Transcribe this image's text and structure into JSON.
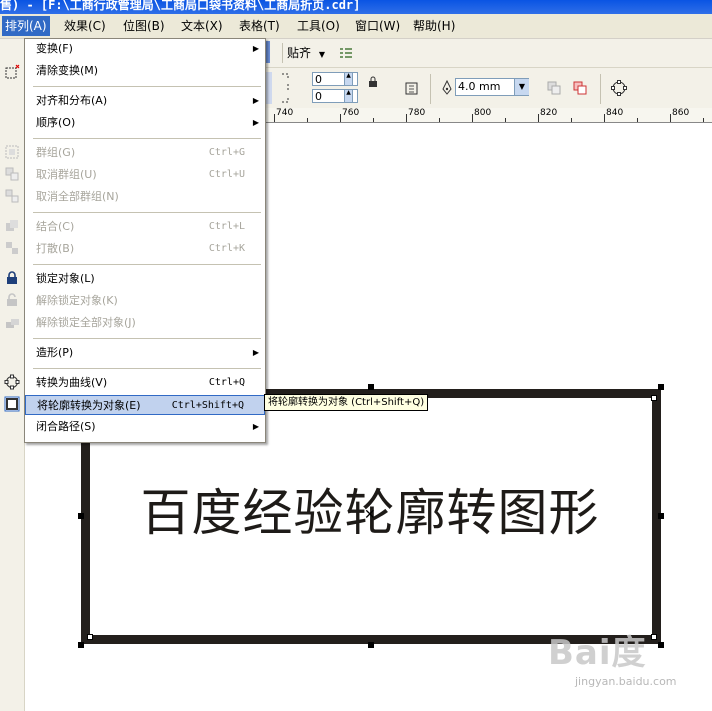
{
  "window": {
    "title": "售) - [F:\\工商行政管理局\\工商局口袋书资料\\工商局折页.cdr]"
  },
  "menubar": {
    "items": [
      {
        "label": "排列(A)"
      },
      {
        "label": "效果(C)"
      },
      {
        "label": "位图(B)"
      },
      {
        "label": "文本(X)"
      },
      {
        "label": "表格(T)"
      },
      {
        "label": "工具(O)"
      },
      {
        "label": "窗口(W)"
      },
      {
        "label": "帮助(H)"
      }
    ]
  },
  "toolbar1": {
    "snap_label": "贴齐"
  },
  "toolbar2": {
    "field1": "0",
    "field2": "0",
    "outline_width": "4.0 mm"
  },
  "ruler": {
    "labels": [
      "740",
      "760",
      "780",
      "800",
      "820",
      "840",
      "860"
    ]
  },
  "arrange_menu": {
    "items": [
      {
        "label": "变换(F)",
        "shortcut": "",
        "submenu": true,
        "enabled": true
      },
      {
        "label": "清除变换(M)",
        "shortcut": "",
        "submenu": false,
        "enabled": true
      },
      {
        "label": "对齐和分布(A)",
        "shortcut": "",
        "submenu": true,
        "enabled": true
      },
      {
        "label": "顺序(O)",
        "shortcut": "",
        "submenu": true,
        "enabled": true
      },
      {
        "label": "群组(G)",
        "shortcut": "Ctrl+G",
        "submenu": false,
        "enabled": false
      },
      {
        "label": "取消群组(U)",
        "shortcut": "Ctrl+U",
        "submenu": false,
        "enabled": false
      },
      {
        "label": "取消全部群组(N)",
        "shortcut": "",
        "submenu": false,
        "enabled": false
      },
      {
        "label": "结合(C)",
        "shortcut": "Ctrl+L",
        "submenu": false,
        "enabled": false
      },
      {
        "label": "打散(B)",
        "shortcut": "Ctrl+K",
        "submenu": false,
        "enabled": false
      },
      {
        "label": "锁定对象(L)",
        "shortcut": "",
        "submenu": false,
        "enabled": true
      },
      {
        "label": "解除锁定对象(K)",
        "shortcut": "",
        "submenu": false,
        "enabled": false
      },
      {
        "label": "解除锁定全部对象(J)",
        "shortcut": "",
        "submenu": false,
        "enabled": false
      },
      {
        "label": "造形(P)",
        "shortcut": "",
        "submenu": true,
        "enabled": true
      },
      {
        "label": "转换为曲线(V)",
        "shortcut": "Ctrl+Q",
        "submenu": false,
        "enabled": true
      },
      {
        "label": "将轮廓转换为对象(E)",
        "shortcut": "Ctrl+Shift+Q",
        "submenu": false,
        "enabled": true,
        "highlighted": true
      },
      {
        "label": "闭合路径(S)",
        "shortcut": "",
        "submenu": true,
        "enabled": true
      }
    ]
  },
  "tooltip": {
    "text": "将轮廓转换为对象 (Ctrl+Shift+Q)"
  },
  "canvas": {
    "text": "百度经验轮廓转图形"
  },
  "watermark": {
    "brand": "Bai度",
    "url": "jingyan.baidu.com"
  },
  "colors": {
    "menu_highlight": "#c1d2ee",
    "menubar_active": "#316ac5",
    "frame": "#231f1c"
  }
}
